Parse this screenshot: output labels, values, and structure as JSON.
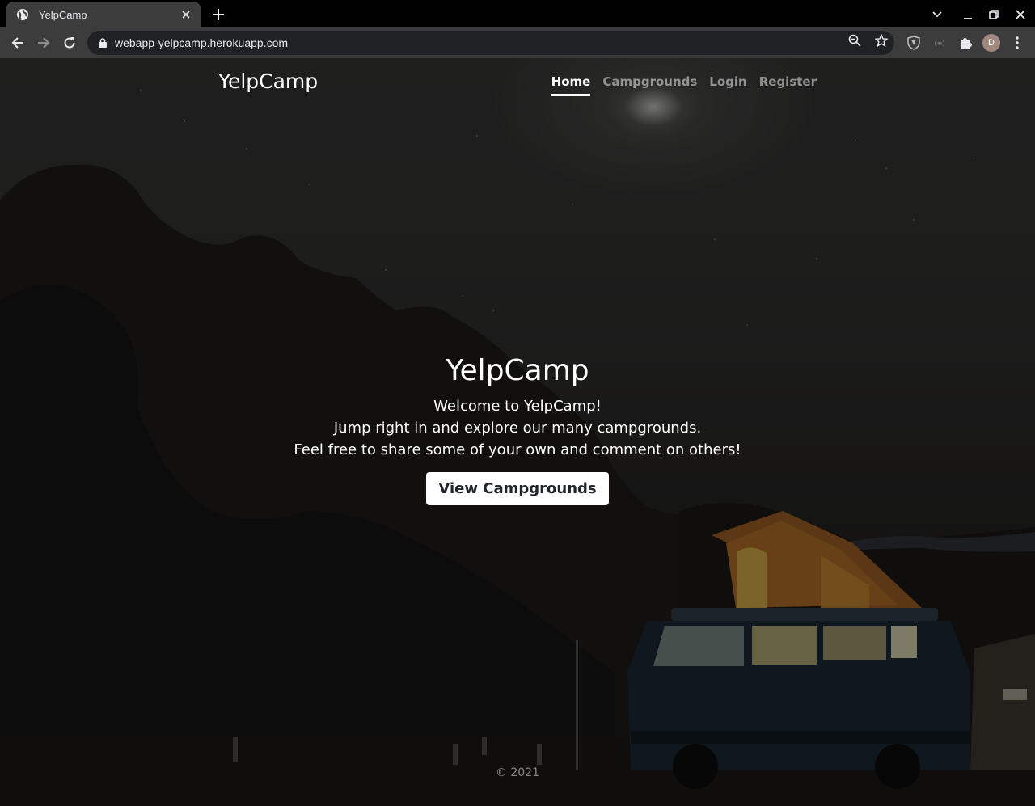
{
  "browser": {
    "tab_title": "YelpCamp",
    "url": "webapp-yelpcamp.herokuapp.com",
    "profile_initial": "D"
  },
  "site": {
    "brand": "YelpCamp",
    "nav": {
      "home": "Home",
      "campgrounds": "Campgrounds",
      "login": "Login",
      "register": "Register"
    },
    "hero": {
      "title": "YelpCamp",
      "line1": "Welcome to YelpCamp!",
      "line2": "Jump right in and explore our many campgrounds.",
      "line3": "Feel free to share some of your own and comment on others!",
      "button": "View Campgrounds"
    },
    "footer": "© 2021"
  }
}
